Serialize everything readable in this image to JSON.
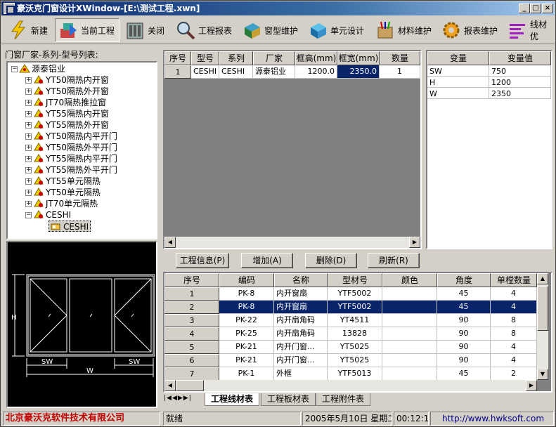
{
  "window": {
    "title": "豪沃克门窗设计XWindow-[E:\\测试工程.xwn]",
    "controls": {
      "minimize": "_",
      "maximize": "□",
      "close": "×"
    }
  },
  "toolbar": [
    {
      "label": "新建",
      "icon": "lightning-icon"
    },
    {
      "label": "当前工程",
      "icon": "project-icon",
      "active": true
    },
    {
      "label": "关闭",
      "icon": "cabinet-icon"
    },
    {
      "label": "工程报表",
      "icon": "magnifier-icon"
    },
    {
      "label": "窗型维护",
      "icon": "window-type-icon"
    },
    {
      "label": "单元设计",
      "icon": "unit-design-icon"
    },
    {
      "label": "材料维护",
      "icon": "material-box-icon"
    },
    {
      "label": "报表维护",
      "icon": "gear-icon"
    },
    {
      "label": "线材优",
      "icon": "bars-icon"
    }
  ],
  "left_panel": {
    "label": "门窗厂家-系列-型号列表:",
    "root": "源泰铝业",
    "series": [
      "YT50隔热内开窗",
      "YT50隔热外开窗",
      "JT70隔热推拉窗",
      "YT55隔热内开窗",
      "YT55隔热外开窗",
      "YT50隔热内平开门",
      "YT50隔热外平开门",
      "YT55隔热内平开门",
      "YT55隔热外平开门",
      "YT55单元隔热",
      "YT50单元隔热",
      "JT70单元隔热"
    ],
    "expanded": "CESHI",
    "child": "CESHI",
    "preview": {
      "label_sw_left": "SW",
      "label_sw_right": "SW",
      "label_w": "W",
      "label_h": "H"
    }
  },
  "project_grid": {
    "headers": [
      "序号",
      "型号",
      "系列",
      "厂家",
      "框高(mm)",
      "框宽(mm)",
      "数量"
    ],
    "rows": [
      [
        "1",
        "CESHI",
        "CESHI",
        "源泰铝业",
        "1200.0",
        "2350.0",
        "1"
      ]
    ]
  },
  "var_grid": {
    "headers": [
      "变量",
      "变量值"
    ],
    "rows": [
      [
        "SW",
        "750"
      ],
      [
        "H",
        "1200"
      ],
      [
        "W",
        "2350"
      ]
    ]
  },
  "buttons": {
    "info": "工程信息(P)",
    "add": "增加(A)",
    "delete": "删除(D)",
    "refresh": "刷新(R)"
  },
  "material_grid": {
    "headers": [
      "序号",
      "编码",
      "名称",
      "型材号",
      "颜色",
      "角度",
      "单樘数量"
    ],
    "rows": [
      [
        "1",
        "PK-8",
        "内开窗扇",
        "YTF5002",
        "",
        "45",
        "4"
      ],
      [
        "2",
        "PK-8",
        "内开窗扇",
        "YTF5002",
        "",
        "45",
        "4"
      ],
      [
        "3",
        "PK-22",
        "内开扇角码",
        "YT4511",
        "",
        "90",
        "8"
      ],
      [
        "4",
        "PK-25",
        "内开扇角码",
        "13828",
        "",
        "90",
        "8"
      ],
      [
        "5",
        "PK-21",
        "内开门窗...",
        "YT5025",
        "",
        "90",
        "4"
      ],
      [
        "6",
        "PK-21",
        "内开门窗...",
        "YT5025",
        "",
        "90",
        "4"
      ],
      [
        "7",
        "PK-1",
        "外框",
        "YTF5013",
        "",
        "45",
        "2"
      ]
    ]
  },
  "tabs": [
    "工程线材表",
    "工程板材表",
    "工程附件表"
  ],
  "status": {
    "company": "北京豪沃克软件技术有限公司",
    "state": "就绪",
    "date": "2005年5月10日 星期二",
    "time": "00:12:16",
    "url": "http://www.hwksoft.com"
  }
}
